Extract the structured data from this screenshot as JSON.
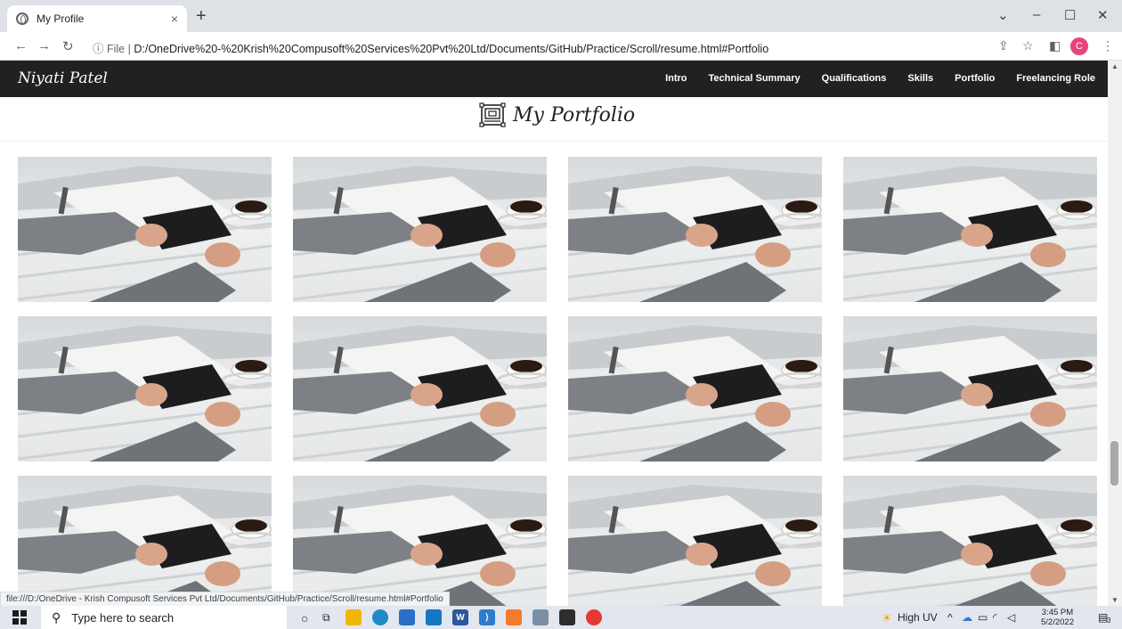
{
  "browser": {
    "tab_title": "My Profile",
    "tab_close": "×",
    "new_tab": "+",
    "url_scheme": "File",
    "url": "D:/OneDrive%20-%20Krish%20Compusoft%20Services%20Pvt%20Ltd/Documents/GitHub/Practice/Scroll/resume.html#Portfolio",
    "profile_initial": "C",
    "status_link": "file:///D:/OneDrive - Krish Compusoft Services Pvt Ltd/Documents/GitHub/Practice/Scroll/resume.html#Portfolio"
  },
  "site": {
    "brand": "Niyati Patel",
    "menu": [
      "Intro",
      "Technical Summary",
      "Qualifications",
      "Skills",
      "Portfolio",
      "Freelancing Role"
    ],
    "section_title": "My Portfolio"
  },
  "portfolio_tiles": 12,
  "taskbar": {
    "search_placeholder": "Type here to search",
    "weather": "High UV",
    "time": "3:45 PM",
    "date": "5/2/2022",
    "notifications": "3"
  }
}
